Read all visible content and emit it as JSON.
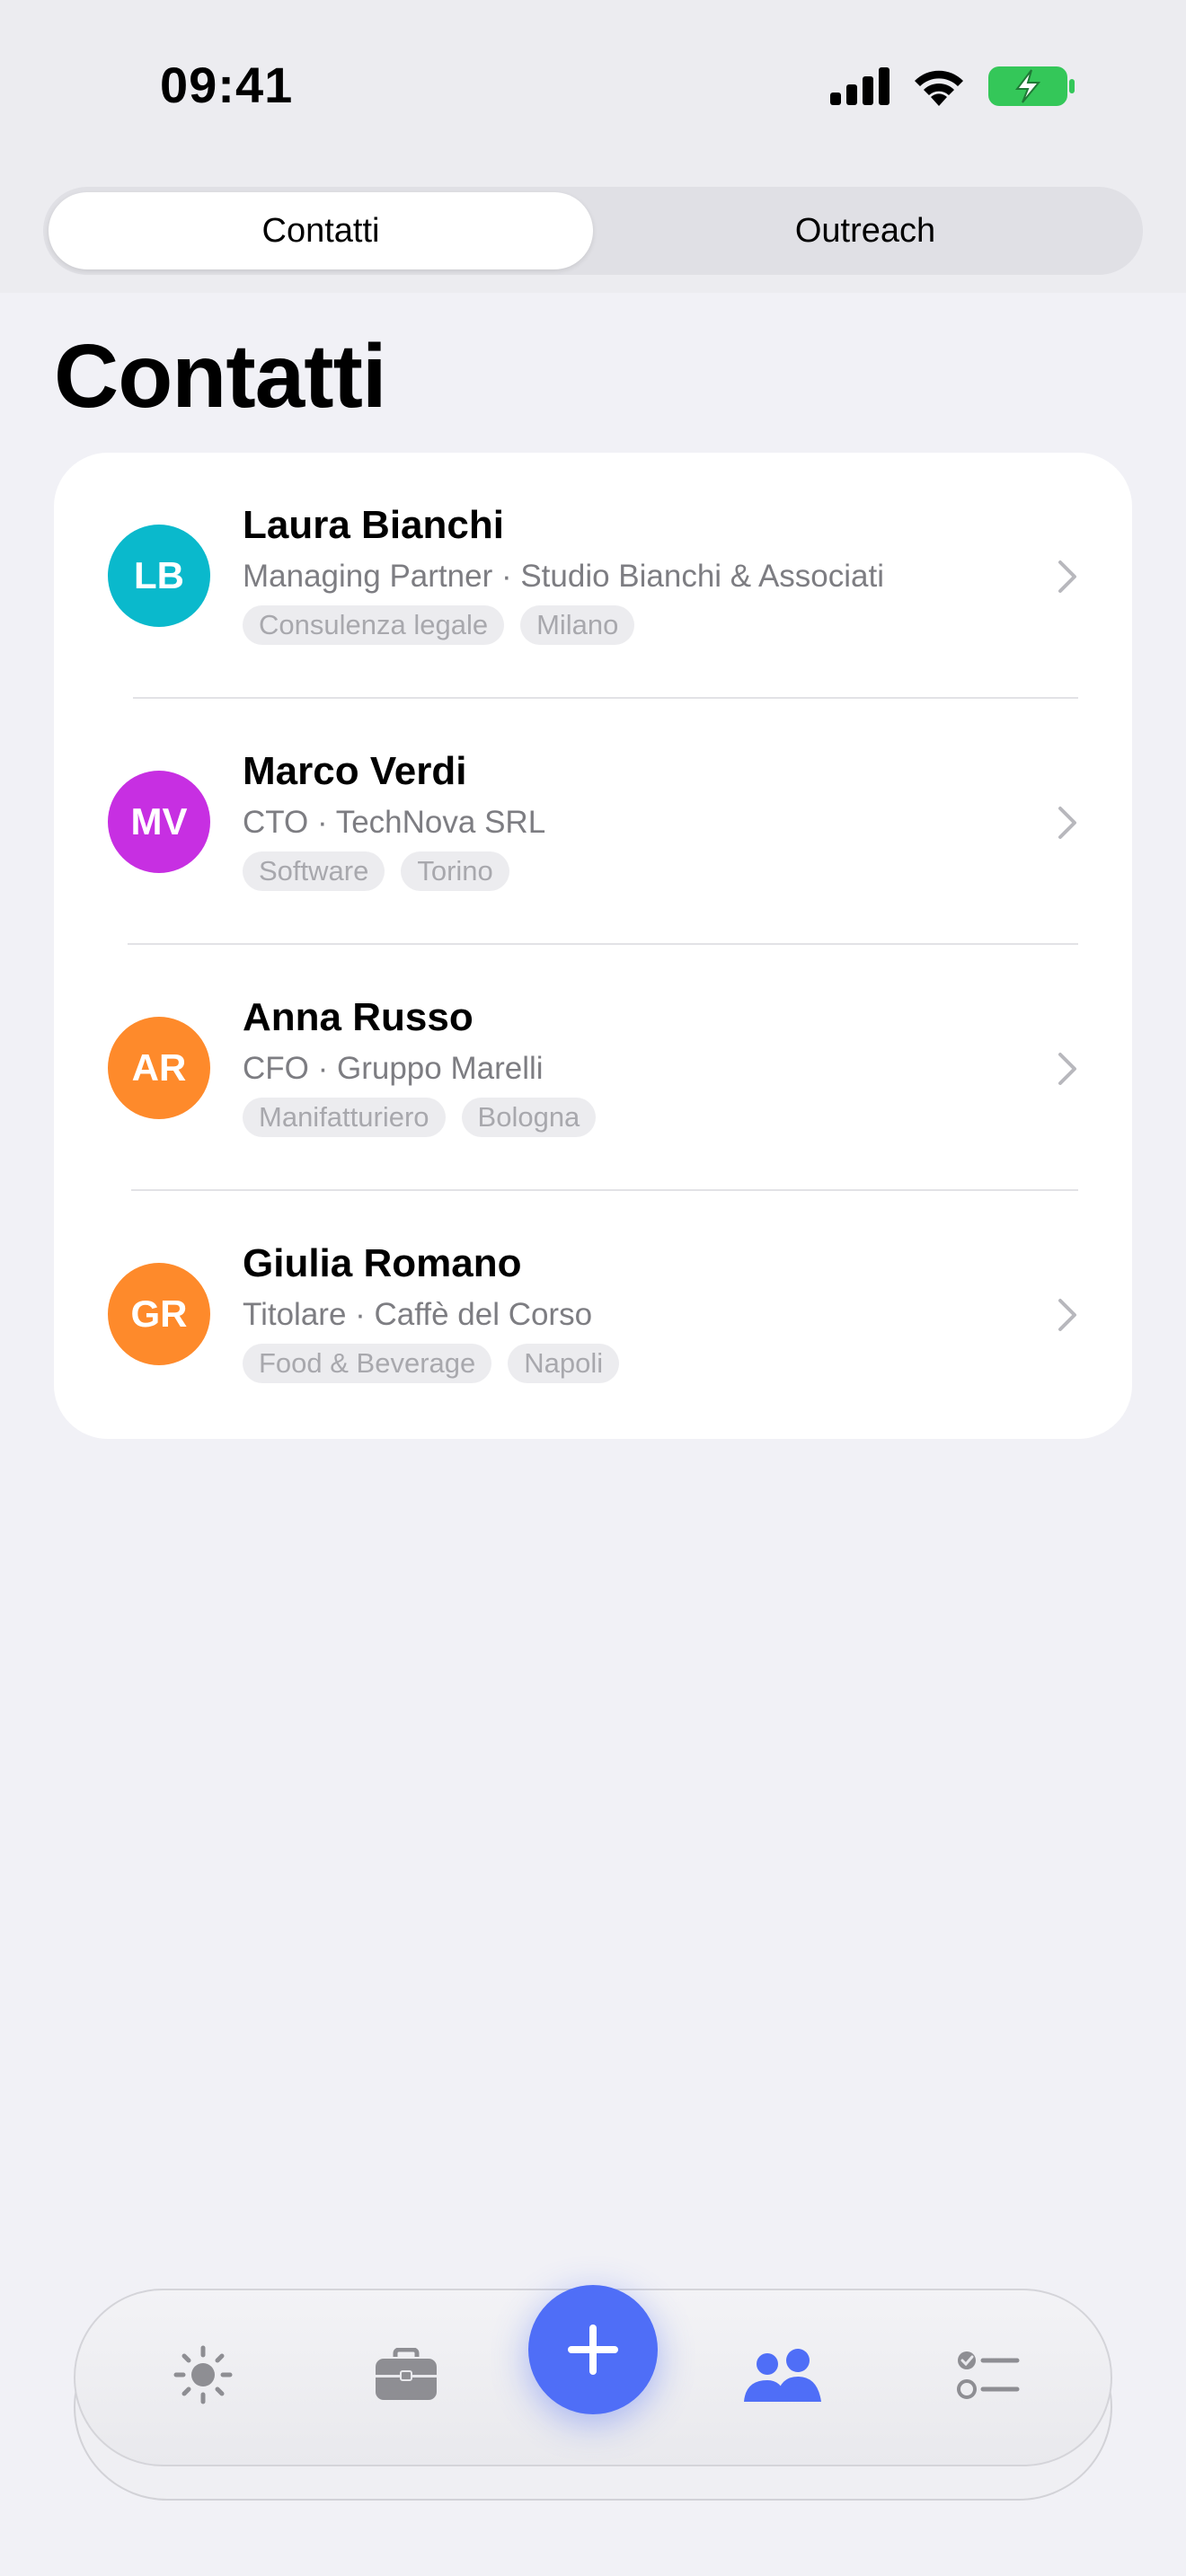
{
  "status_bar": {
    "time": "09:41"
  },
  "segmented": {
    "contacts_label": "Contatti",
    "outreach_label": "Outreach",
    "selected": "Contatti"
  },
  "page": {
    "title": "Contatti"
  },
  "contacts": [
    {
      "initials": "LB",
      "name": "Laura Bianchi",
      "subtitle": "Managing Partner · Studio Bianchi & Associati",
      "tags": [
        "Consulenza legale",
        "Milano"
      ],
      "avatar_color": "#0ab9cc"
    },
    {
      "initials": "MV",
      "name": "Marco Verdi",
      "subtitle": "CTO · TechNova SRL",
      "tags": [
        "Software",
        "Torino"
      ],
      "avatar_color": "#c72fe2"
    },
    {
      "initials": "AR",
      "name": "Anna Russo",
      "subtitle": "CFO · Gruppo Marelli",
      "tags": [
        "Manifatturiero",
        "Bologna"
      ],
      "avatar_color": "#fe8a2b"
    },
    {
      "initials": "GR",
      "name": "Giulia Romano",
      "subtitle": "Titolare · Caffè del Corso",
      "tags": [
        "Food & Beverage",
        "Napoli"
      ],
      "avatar_color": "#fe8a2b"
    }
  ],
  "tab_bar": {
    "items": [
      "sun-icon",
      "briefcase-icon",
      "plus-icon",
      "people-icon",
      "checklist-icon"
    ],
    "active": "people-icon",
    "accent": "#4f6ef7"
  }
}
